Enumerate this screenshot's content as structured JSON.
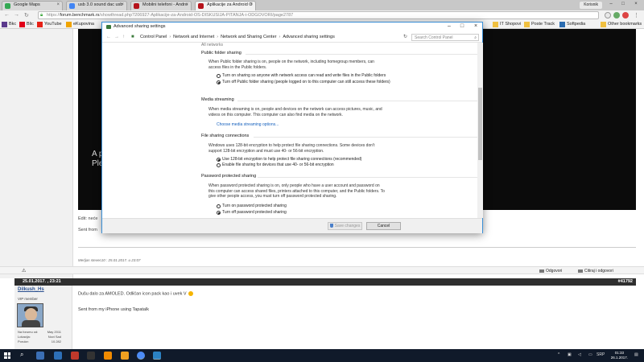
{
  "browser": {
    "tabs": [
      {
        "label": "Google Maps",
        "active": false,
        "color": "#34a853"
      },
      {
        "label": "usb 3.0 sound dac usb",
        "active": false,
        "color": "#4285f4"
      },
      {
        "label": "Mobilni telefoni - Andro",
        "active": false,
        "color": "#b5121b"
      },
      {
        "label": "Aplikacije za Android O",
        "active": true,
        "color": "#b5121b"
      }
    ],
    "user": "Korisnik",
    "url_prefix": "https://",
    "url_host": "forum.benchmark.rs",
    "url_path": "/showthread.php?206927-Aplikacije-za-Android-OS-DISKUSIJA-PITANJA-i-ODGOVORI/page2787",
    "bookmarks": [
      {
        "label": "Bkc",
        "color": "#5b3a8c"
      },
      {
        "label": "Blic",
        "color": "#e1001a"
      },
      {
        "label": "YouTube",
        "color": "#e62117"
      },
      {
        "label": "eKupovina",
        "color": "#f0a400"
      },
      {
        "label": "IT Shopovi",
        "color": "#f0c040"
      },
      {
        "label": "Poste Track",
        "color": "#f0c040"
      },
      {
        "label": "Softpedia",
        "color": "#2b6cb0"
      },
      {
        "label": "Other bookmarks",
        "color": "#f0c040"
      }
    ]
  },
  "forum": {
    "video_text_1": "A p",
    "video_text_2": "Plea",
    "edit_text": "Edit: neće",
    "sent_text": "Sent from",
    "edited_note": "Merljas stevec10 : 25.01.2017. u 23:07",
    "actions": {
      "reply": "Odgovori",
      "quote_reply": "Citiraj i odgovori"
    },
    "post": {
      "date": "25.01.2017. , 23:21",
      "number": "#41792",
      "username": "Dilkush_Hs",
      "user_title": "VIP member",
      "stats": [
        {
          "label": "Na forumu od:",
          "value": "May 2011"
        },
        {
          "label": "Lokacija:",
          "value": "Novi Sad"
        },
        {
          "label": "Poruke:",
          "value": "10.282"
        }
      ],
      "text_1": "Dušu dalo za AMOLED. Odličan icon pack kao i uvek V",
      "text_2": "Sent from my iPhone using Tapatalk"
    }
  },
  "dialog": {
    "title": "Advanced sharing settings",
    "breadcrumbs": [
      "Control Panel",
      "Network and Internet",
      "Network and Sharing Center",
      "Advanced sharing settings"
    ],
    "search_placeholder": "Search Control Panel",
    "ghost_header": "All networks",
    "public_folder": {
      "heading": "Public folder sharing",
      "desc": "When Public folder sharing is on, people on the network, including homegroup members, can access files in the Public folders.",
      "opt_on": "Turn on sharing so anyone with network access can read and write files in the Public folders",
      "opt_off": "Turn off Public folder sharing (people logged on to this computer can still access these folders)"
    },
    "media": {
      "heading": "Media streaming",
      "desc": "When media streaming is on, people and devices on the network can access pictures, music, and videos on this computer. This computer can also find media on the network.",
      "link": "Choose media streaming options..."
    },
    "file_sharing": {
      "heading": "File sharing connections",
      "desc": "Windows uses 128-bit encryption to help protect file sharing connections. Some devices don't support 128-bit encryption and must use 40- or 56-bit encryption.",
      "opt_128": "Use 128-bit encryption to help protect file sharing connections (recommended)",
      "opt_40": "Enable file sharing for devices that use 40- or 56-bit encryption"
    },
    "password": {
      "heading": "Password protected sharing",
      "desc": "When password protected sharing is on, only people who have a user account and password on this computer can access shared files, printers attached to this computer, and the Public folders. To give other people access, you must turn off password protected sharing.",
      "opt_on": "Turn on password protected sharing",
      "opt_off": "Turn off password protected sharing"
    },
    "save_label": "Save changes",
    "cancel_label": "Cancel"
  },
  "taskbar": {
    "lang": "SRP",
    "time": "01:33",
    "date": "26.1.2017."
  }
}
